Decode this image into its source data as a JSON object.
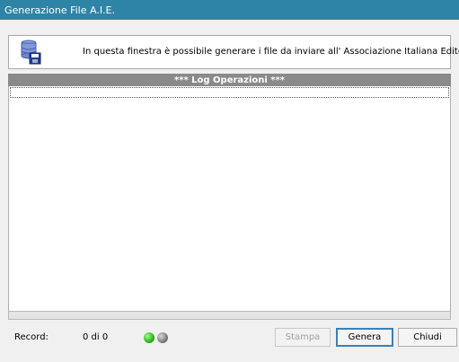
{
  "window": {
    "title": "Generazione File A.I.E."
  },
  "info": {
    "icon": "database-save-icon",
    "message": "In questa finestra è possibile generare i file da inviare all' Associazione Italiana Editori ..."
  },
  "log": {
    "header": "*** Log Operazioni ***"
  },
  "status": {
    "record_label": "Record:",
    "record_count": "0 di 0",
    "indicators": [
      {
        "name": "green-status-led",
        "color": "#2fb21a"
      },
      {
        "name": "gray-status-led",
        "color": "#7d7d7d"
      }
    ]
  },
  "buttons": {
    "stampa": "Stampa",
    "genera": "Genera",
    "chiudi": "Chiudi"
  },
  "colors": {
    "titlebar": "#2e84a6",
    "log_header": "#8a8a8a"
  }
}
